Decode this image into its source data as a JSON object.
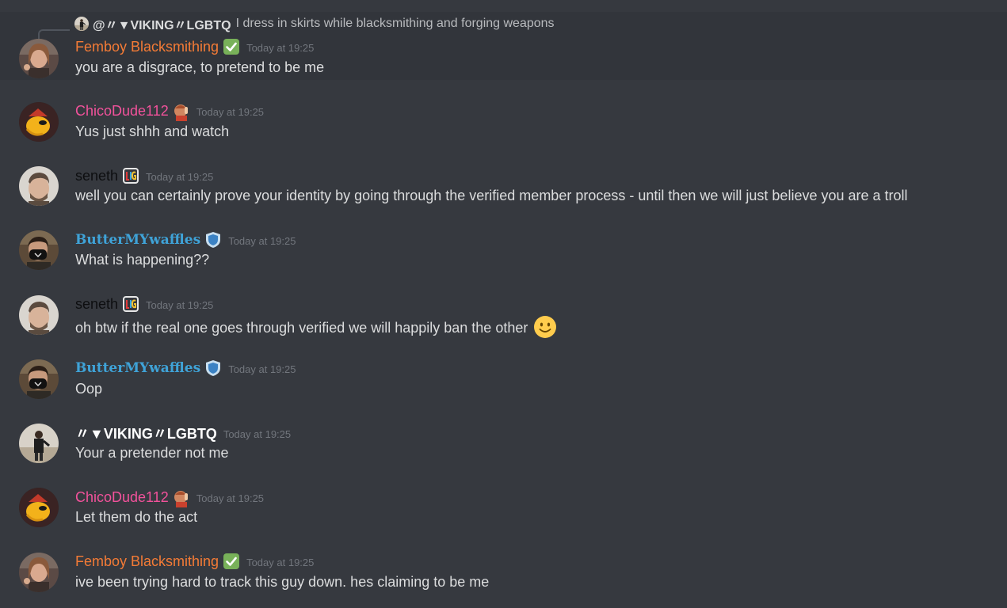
{
  "reply": {
    "author": "@〃▼VIKING〃LGBTQ",
    "text": "I dress in skirts while blacksmithing and forging weapons"
  },
  "messages": [
    {
      "author": "Femboy Blacksmithing",
      "timestamp": "Today at 19:25",
      "content": "you are a disgrace, to pretend to be me",
      "name_color": "#f47b36",
      "badge": "verified-check-icon"
    },
    {
      "author": "ChicoDude112",
      "timestamp": "Today at 19:25",
      "content": "Yus just shhh and watch",
      "name_color": "#f2529b",
      "badge": "thumbs-up-girl-icon"
    },
    {
      "author": "seneth",
      "timestamp": "Today at 19:25",
      "content": "well you can certainly prove your identity by going through the verified member process - until then we will just believe you are a troll",
      "name_color": "#0d0e10",
      "badge": "lgbt-badge-icon"
    },
    {
      "author": "ButterMYwaffles",
      "timestamp": "Today at 19:25",
      "content": "What is happening??",
      "name_color": "#3fa3d8",
      "badge": "shield-icon"
    },
    {
      "author": "seneth",
      "timestamp": "Today at 19:25",
      "content": "oh btw if the real one goes through verified we will happily ban the other",
      "name_color": "#0d0e10",
      "badge": "lgbt-badge-icon",
      "emoji": "slight-smile-emoji"
    },
    {
      "author": "ButterMYwaffles",
      "timestamp": "Today at 19:25",
      "content": "Oop",
      "name_color": "#3fa3d8",
      "badge": "shield-icon"
    },
    {
      "author": "〃▼VIKING〃LGBTQ",
      "timestamp": "Today at 19:25",
      "content": "Your a pretender not me",
      "name_color": "#ffffff"
    },
    {
      "author": "ChicoDude112",
      "timestamp": "Today at 19:25",
      "content": "Let them do the act",
      "name_color": "#f2529b",
      "badge": "thumbs-up-girl-icon"
    },
    {
      "author": "Femboy Blacksmithing",
      "timestamp": "Today at 19:25",
      "content": "ive been trying hard to track this guy down. hes claiming to be me",
      "name_color": "#f47b36",
      "badge": "verified-check-icon"
    }
  ],
  "colors": {
    "background": "#36393f",
    "highlight": "#32353b",
    "timestamp": "#72767d",
    "text": "#dcddde"
  }
}
